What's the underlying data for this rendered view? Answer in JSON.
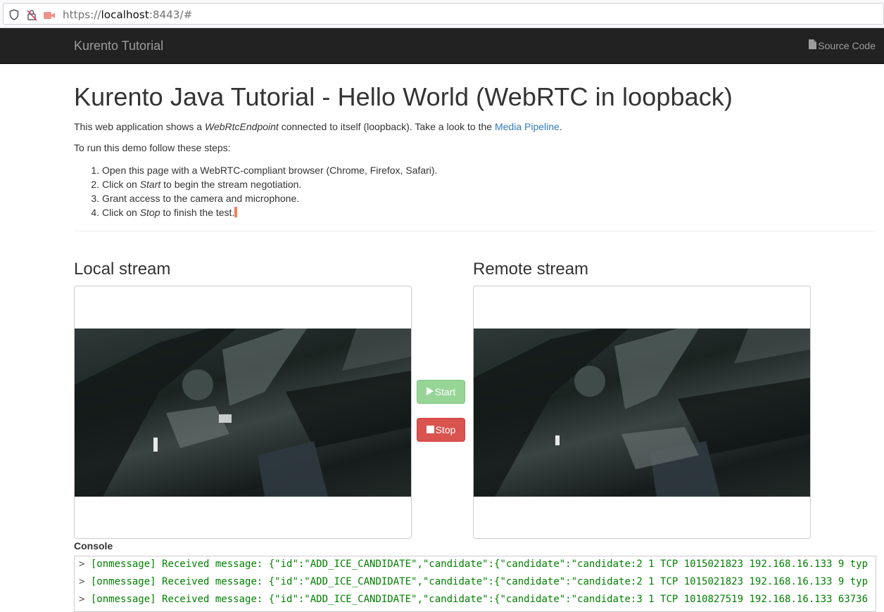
{
  "browser": {
    "url_prefix": "https://",
    "url_host": "localhost",
    "url_rest": ":8443/#"
  },
  "navbar": {
    "brand": "Kurento Tutorial",
    "source_code": "Source Code"
  },
  "page": {
    "title": "Kurento Java Tutorial - Hello World (WebRTC in loopback)",
    "intro_before": "This web application shows a ",
    "intro_em": "WebRtcEndpoint",
    "intro_after": " connected to itself (loopback). Take a look to the ",
    "intro_link": "Media Pipeline",
    "intro_end": ".",
    "steps_intro": "To run this demo follow these steps:",
    "steps": [
      {
        "text": "Open this page with a WebRTC-compliant browser (Chrome, Firefox, Safari)."
      },
      {
        "before": "Click on ",
        "em": "Start",
        "after": " to begin the stream negotiation."
      },
      {
        "text": "Grant access to the camera and microphone."
      },
      {
        "before": "Click on ",
        "em": "Stop",
        "after": " to finish the test."
      }
    ]
  },
  "streams": {
    "local_title": "Local stream",
    "remote_title": "Remote stream"
  },
  "buttons": {
    "start_label": "Start",
    "stop_label": "Stop"
  },
  "console": {
    "label": "Console",
    "prompt": ">",
    "lines": [
      "[onmessage] Received message: {\"id\":\"ADD_ICE_CANDIDATE\",\"candidate\":{\"candidate\":\"candidate:2 1 TCP 1015021823 192.168.16.133 9 typ",
      "[onmessage] Received message: {\"id\":\"ADD_ICE_CANDIDATE\",\"candidate\":{\"candidate\":\"candidate:2 1 TCP 1015021823 192.168.16.133 9 typ",
      "[onmessage] Received message: {\"id\":\"ADD_ICE_CANDIDATE\",\"candidate\":{\"candidate\":\"candidate:3 1 TCP 1010827519 192.168.16.133 63736"
    ]
  },
  "colors": {
    "navbar_bg": "#222222",
    "link": "#337ab7",
    "start_button": "#8cd18c",
    "stop_button": "#d9534f",
    "console_text": "#008000"
  }
}
